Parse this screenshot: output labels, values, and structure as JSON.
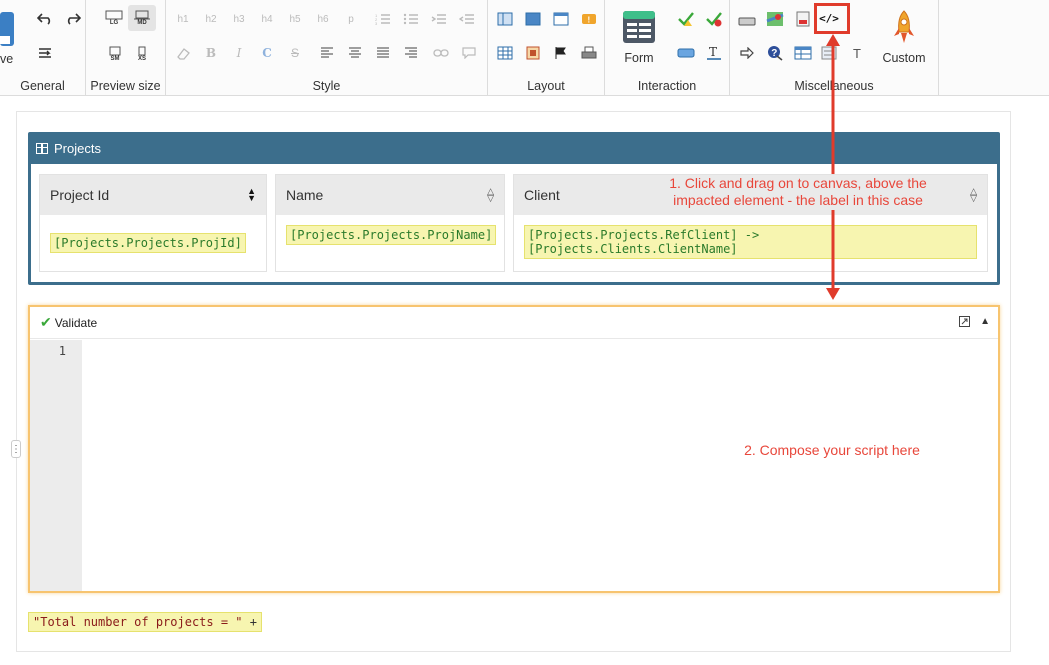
{
  "toolbar": {
    "groups": {
      "general": "General",
      "preview_size": "Preview size",
      "style": "Style",
      "layout": "Layout",
      "interaction": "Interaction",
      "miscellaneous": "Miscellaneous"
    },
    "save_label_partial": "ve",
    "preview": {
      "lg": "LG",
      "md": "MD",
      "sm": "SM",
      "xs": "XS"
    },
    "headings": [
      "h1",
      "h2",
      "h3",
      "h4",
      "h5",
      "h6",
      "p"
    ],
    "form_label": "Form",
    "custom_label": "Custom",
    "code_icon": "</>",
    "bold": "B",
    "italic": "I",
    "strike": "S",
    "text_icon": "T"
  },
  "panel": {
    "title": "Projects",
    "columns": [
      {
        "header": "Project Id",
        "value": "[Projects.Projects.ProjId]"
      },
      {
        "header": "Name",
        "value": "[Projects.Projects.ProjName]"
      },
      {
        "header": "Client",
        "value": "[Projects.Projects.RefClient] -> [Projects.Clients.ClientName]"
      }
    ]
  },
  "editor": {
    "validate_label": "Validate",
    "line_number": "1"
  },
  "bottom_chip": {
    "text": "\"Total number of projects = \"",
    "op": "+"
  },
  "annotations": {
    "step1": "1. Click and drag on to canvas, above the impacted element - the label in this case",
    "step2": "2. Compose your script here"
  },
  "colors": {
    "panel": "#3c6e8c",
    "annotation": "#e8473b",
    "editor_border": "#f7c46f",
    "chip_bg": "#f7f5b0"
  }
}
